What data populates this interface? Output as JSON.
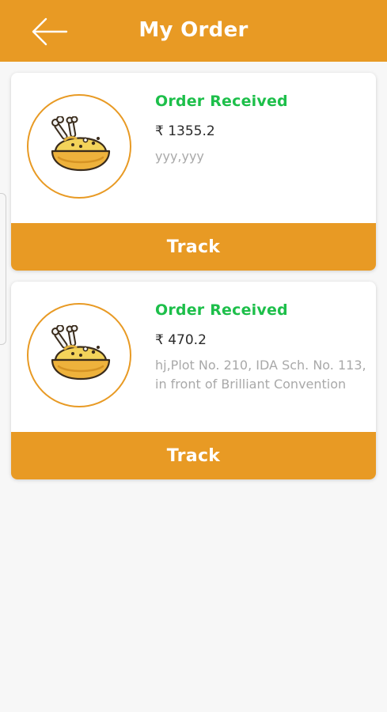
{
  "header": {
    "title": "My Order",
    "back_icon": "arrow-left-icon"
  },
  "colors": {
    "primary": "#E89A24",
    "status_green": "#1dbf4a",
    "background": "#f7f7f7"
  },
  "orders": [
    {
      "status": "Order Received",
      "amount": "₹ 1355.2",
      "address": "yyy,yyy",
      "track_label": "Track",
      "icon": "food-bowl-icon"
    },
    {
      "status": "Order Received",
      "amount": "₹ 470.2",
      "address": "hj,Plot No. 210, IDA Sch. No. 113,\nin front of Brilliant Convention",
      "track_label": "Track",
      "icon": "food-bowl-icon"
    }
  ]
}
